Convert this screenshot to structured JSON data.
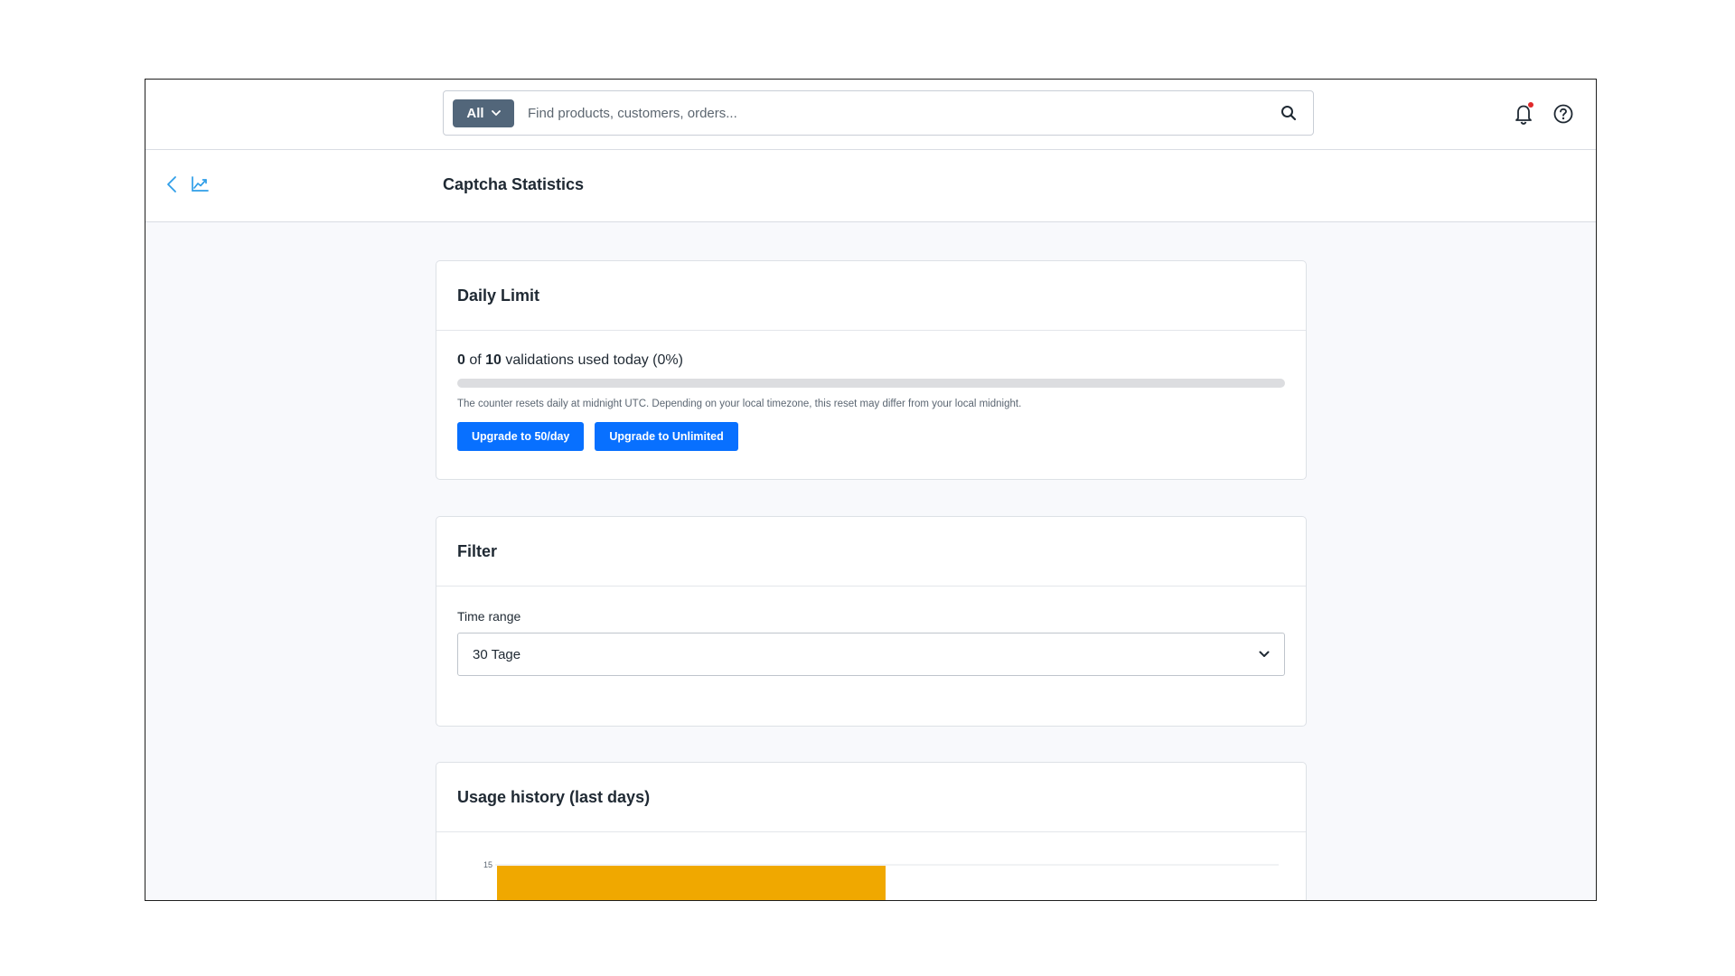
{
  "topbar": {
    "scope_label": "All",
    "search_placeholder": "Find products, customers, orders...",
    "notification_dot_color": "#e0292a"
  },
  "subheader": {
    "title": "Captcha Statistics"
  },
  "daily_limit": {
    "title": "Daily Limit",
    "used": "0",
    "of_text": "of",
    "limit": "10",
    "suffix": "validations used today (0%)",
    "usage_fraction": 0,
    "hint": "The counter resets daily at midnight UTC. Depending on your local timezone, this reset may differ from your local midnight.",
    "upgrade_50_label": "Upgrade to 50/day",
    "upgrade_unlimited_label": "Upgrade to Unlimited"
  },
  "filter": {
    "title": "Filter",
    "time_range_label": "Time range",
    "time_range_value": "30 Tage"
  },
  "usage_history": {
    "title": "Usage history (last days)"
  },
  "chart_data": {
    "type": "bar",
    "y_ticks": [
      "15"
    ],
    "ylim": [
      0,
      15
    ],
    "bar_color": "#f0a800",
    "grid": true
  },
  "colors": {
    "accent": "#0870ff",
    "scope_button": "#52667a",
    "icon_blue": "#2f9ee8"
  }
}
